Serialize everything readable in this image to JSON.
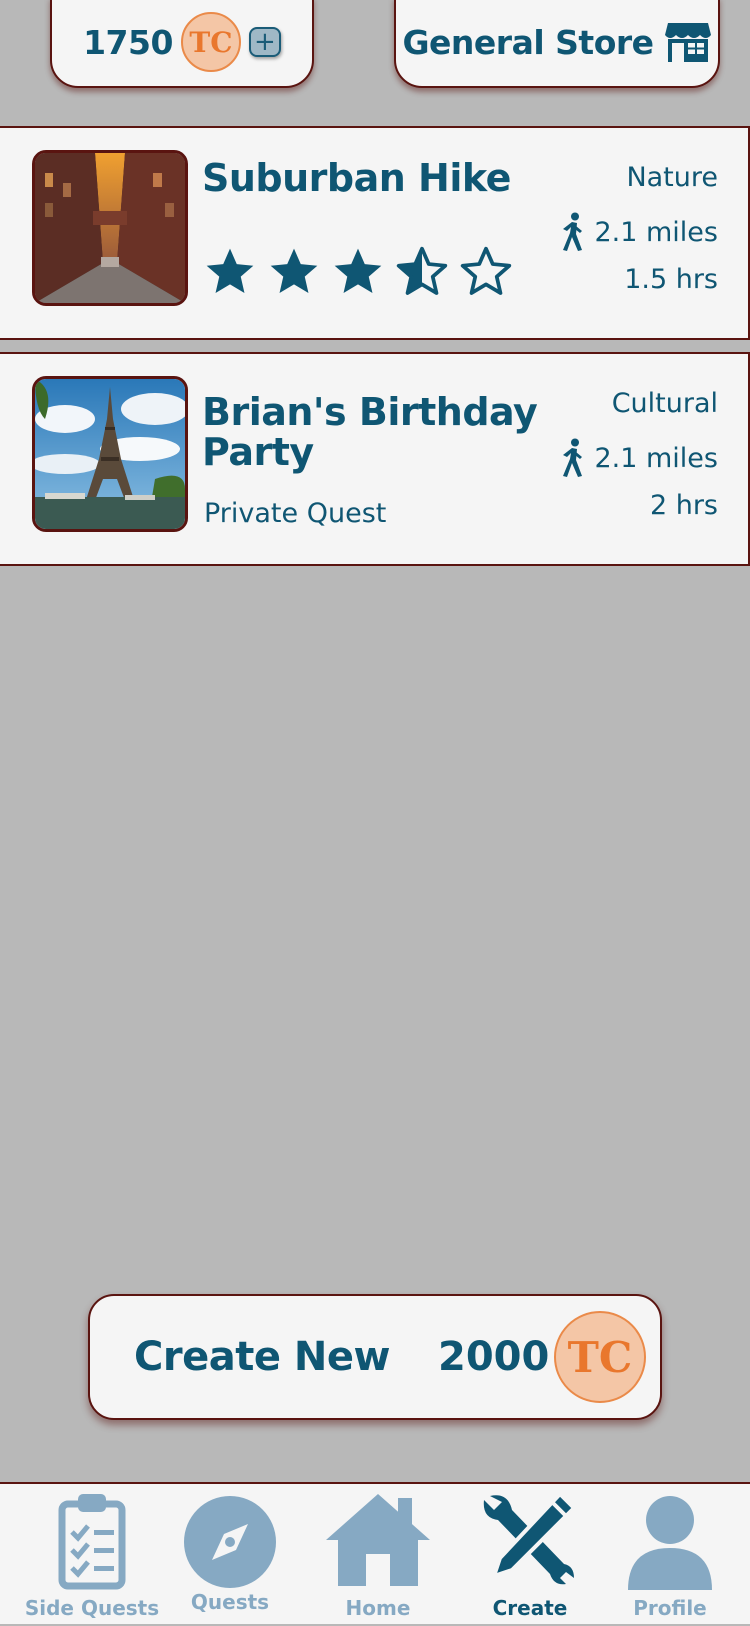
{
  "header": {
    "balance": "1750",
    "coin_label": "TC",
    "add_icon": "plus-square-icon",
    "store_label": "General Store",
    "store_icon": "storefront-icon"
  },
  "quests": [
    {
      "title": "Suburban Hike",
      "category": "Nature",
      "distance": "2.1 miles",
      "duration": "1.5 hrs",
      "rating": 3.5,
      "rating_max": 5,
      "image": "city-street-photo",
      "distance_icon": "walking-icon"
    },
    {
      "title_line1": "Brian's Birthday",
      "title_line2": "Party",
      "subtitle": "Private Quest",
      "category": "Cultural",
      "distance": "2.1 miles",
      "duration": "2 hrs",
      "image": "eiffel-tower-photo",
      "distance_icon": "walking-icon"
    }
  ],
  "create": {
    "label": "Create New",
    "cost": "2000",
    "coin_label": "TC"
  },
  "tabs": [
    {
      "label": "Side Quests",
      "icon": "clipboard-checklist-icon",
      "active": false
    },
    {
      "label": "Quests",
      "icon": "compass-icon",
      "active": false
    },
    {
      "label": "Home",
      "icon": "house-icon",
      "active": false
    },
    {
      "label": "Create",
      "icon": "wrench-pencil-icon",
      "active": true
    },
    {
      "label": "Profile",
      "icon": "person-icon",
      "active": false
    }
  ],
  "colors": {
    "primary": "#0f5673",
    "accent": "#e9772d",
    "border": "#5a1410",
    "background": "#b8b8b8",
    "card": "#f5f5f5",
    "inactive_tab": "#86a9c3"
  }
}
